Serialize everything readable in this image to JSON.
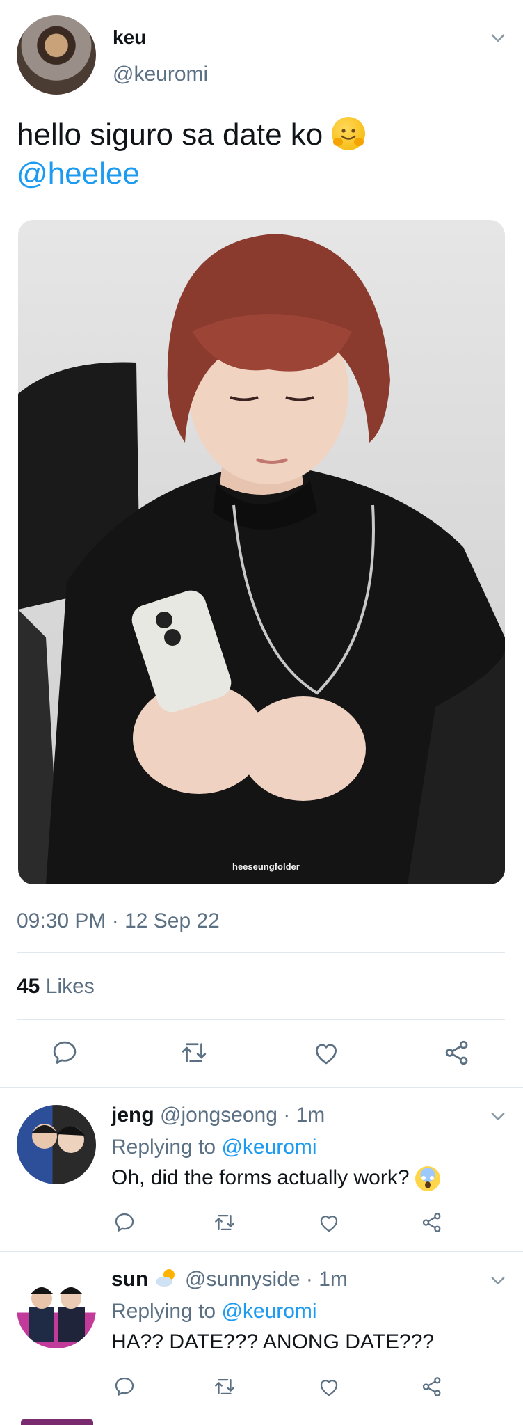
{
  "tweet": {
    "display_name": "keu",
    "handle": "@keuromi",
    "text": "hello siguro sa date ko",
    "text_emoji": "hugging-face",
    "mention": "@heelee",
    "photo_watermark": "heeseungfolder",
    "timestamp": "09:30 PM · 12 Sep 22",
    "likes_count": "45",
    "likes_label": "Likes"
  },
  "actions": [
    "reply",
    "retweet",
    "like",
    "share"
  ],
  "replies": [
    {
      "name": "jeng",
      "handle": "@jongseong",
      "time": "· 1m",
      "replying_prefix": "Replying to",
      "replying_to": "@keuromi",
      "text": "Oh, did the forms actually work?",
      "emoji": "screaming-face"
    },
    {
      "name": "sun",
      "name_emoji": "sun-behind-cloud",
      "handle": "@sunnyside",
      "time": "· 1m",
      "replying_prefix": "Replying to",
      "replying_to": "@keuromi",
      "text": "HA?? DATE??? ANONG DATE???"
    }
  ],
  "colors": {
    "accent": "#1d9bf0",
    "secondary_text": "#5b7083",
    "divider": "#e1e8ed"
  }
}
